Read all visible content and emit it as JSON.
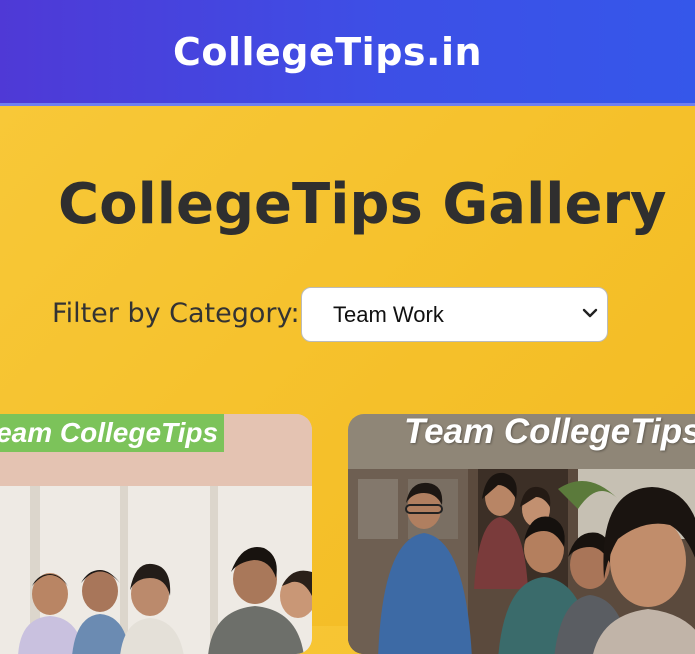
{
  "header": {
    "site_title": "CollegeTips.in"
  },
  "main": {
    "title": "CollegeTips Gallery",
    "filter": {
      "label": "Filter by Category:",
      "selected": "Team Work"
    }
  },
  "gallery": [
    {
      "caption": "Team CollegeTips"
    },
    {
      "caption": "Team CollegeTips"
    }
  ],
  "colors": {
    "header_start": "#4f39d6",
    "header_end": "#3557ea",
    "page_bg": "#f5c02a",
    "label_green": "#7cc35a"
  }
}
